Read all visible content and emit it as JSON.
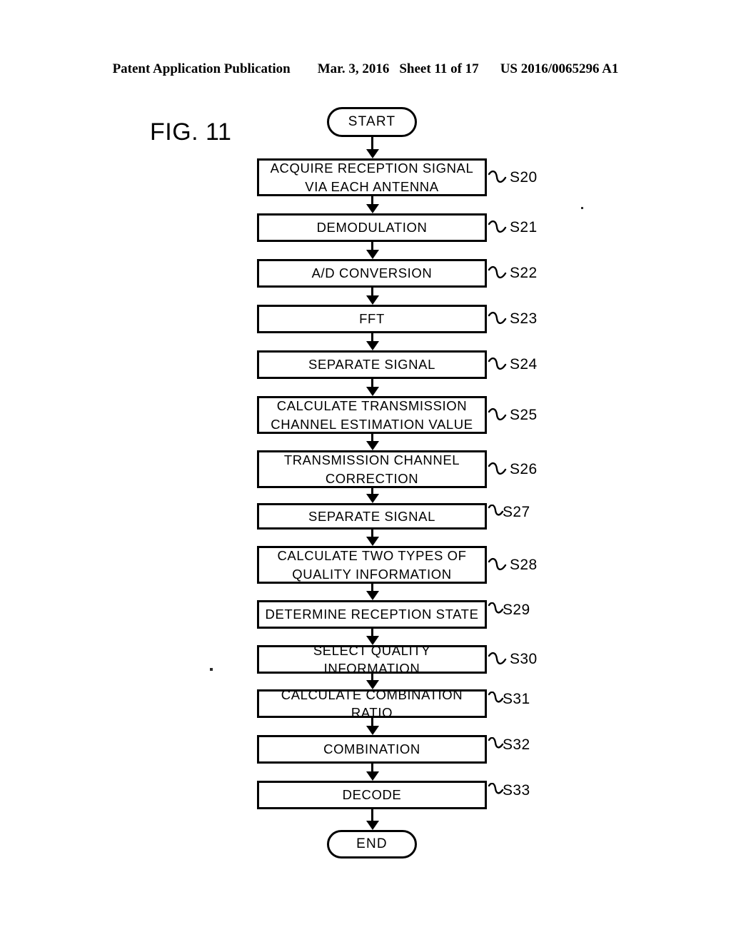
{
  "header": {
    "publication": "Patent Application Publication",
    "date": "Mar. 3, 2016",
    "sheet": "Sheet 11 of 17",
    "patent_number": "US 2016/0065296 A1"
  },
  "figure": {
    "label": "FIG. 11"
  },
  "flowchart": {
    "start_label": "START",
    "end_label": "END",
    "steps": [
      {
        "id": "S20",
        "label": "ACQUIRE RECEPTION SIGNAL\nVIA EACH ANTENNA",
        "lines": [
          "ACQUIRE RECEPTION SIGNAL",
          "VIA EACH ANTENNA"
        ]
      },
      {
        "id": "S21",
        "label": "DEMODULATION",
        "lines": [
          "DEMODULATION"
        ]
      },
      {
        "id": "S22",
        "label": "A/D CONVERSION",
        "lines": [
          "A/D CONVERSION"
        ]
      },
      {
        "id": "S23",
        "label": "FFT",
        "lines": [
          "FFT"
        ]
      },
      {
        "id": "S24",
        "label": "SEPARATE SIGNAL",
        "lines": [
          "SEPARATE SIGNAL"
        ]
      },
      {
        "id": "S25",
        "label": "CALCULATE TRANSMISSION\nCHANNEL ESTIMATION VALUE",
        "lines": [
          "CALCULATE TRANSMISSION",
          "CHANNEL ESTIMATION VALUE"
        ]
      },
      {
        "id": "S26",
        "label": "TRANSMISSION CHANNEL\nCORRECTION",
        "lines": [
          "TRANSMISSION CHANNEL",
          "CORRECTION"
        ]
      },
      {
        "id": "S27",
        "label": "SEPARATE SIGNAL",
        "lines": [
          "SEPARATE SIGNAL"
        ]
      },
      {
        "id": "S28",
        "label": "CALCULATE TWO TYPES OF\nQUALITY INFORMATION",
        "lines": [
          "CALCULATE TWO TYPES OF",
          "QUALITY INFORMATION"
        ]
      },
      {
        "id": "S29",
        "label": "DETERMINE RECEPTION STATE",
        "lines": [
          "DETERMINE RECEPTION STATE"
        ]
      },
      {
        "id": "S30",
        "label": "SELECT QUALITY INFORMATION",
        "lines": [
          "SELECT QUALITY INFORMATION"
        ]
      },
      {
        "id": "S31",
        "label": "CALCULATE COMBINATION RATIO",
        "lines": [
          "CALCULATE COMBINATION RATIO"
        ]
      },
      {
        "id": "S32",
        "label": "COMBINATION",
        "lines": [
          "COMBINATION"
        ]
      },
      {
        "id": "S33",
        "label": "DECODE",
        "lines": [
          "DECODE"
        ]
      }
    ]
  },
  "colors": {
    "ink": "#000000",
    "paper": "#ffffff"
  }
}
